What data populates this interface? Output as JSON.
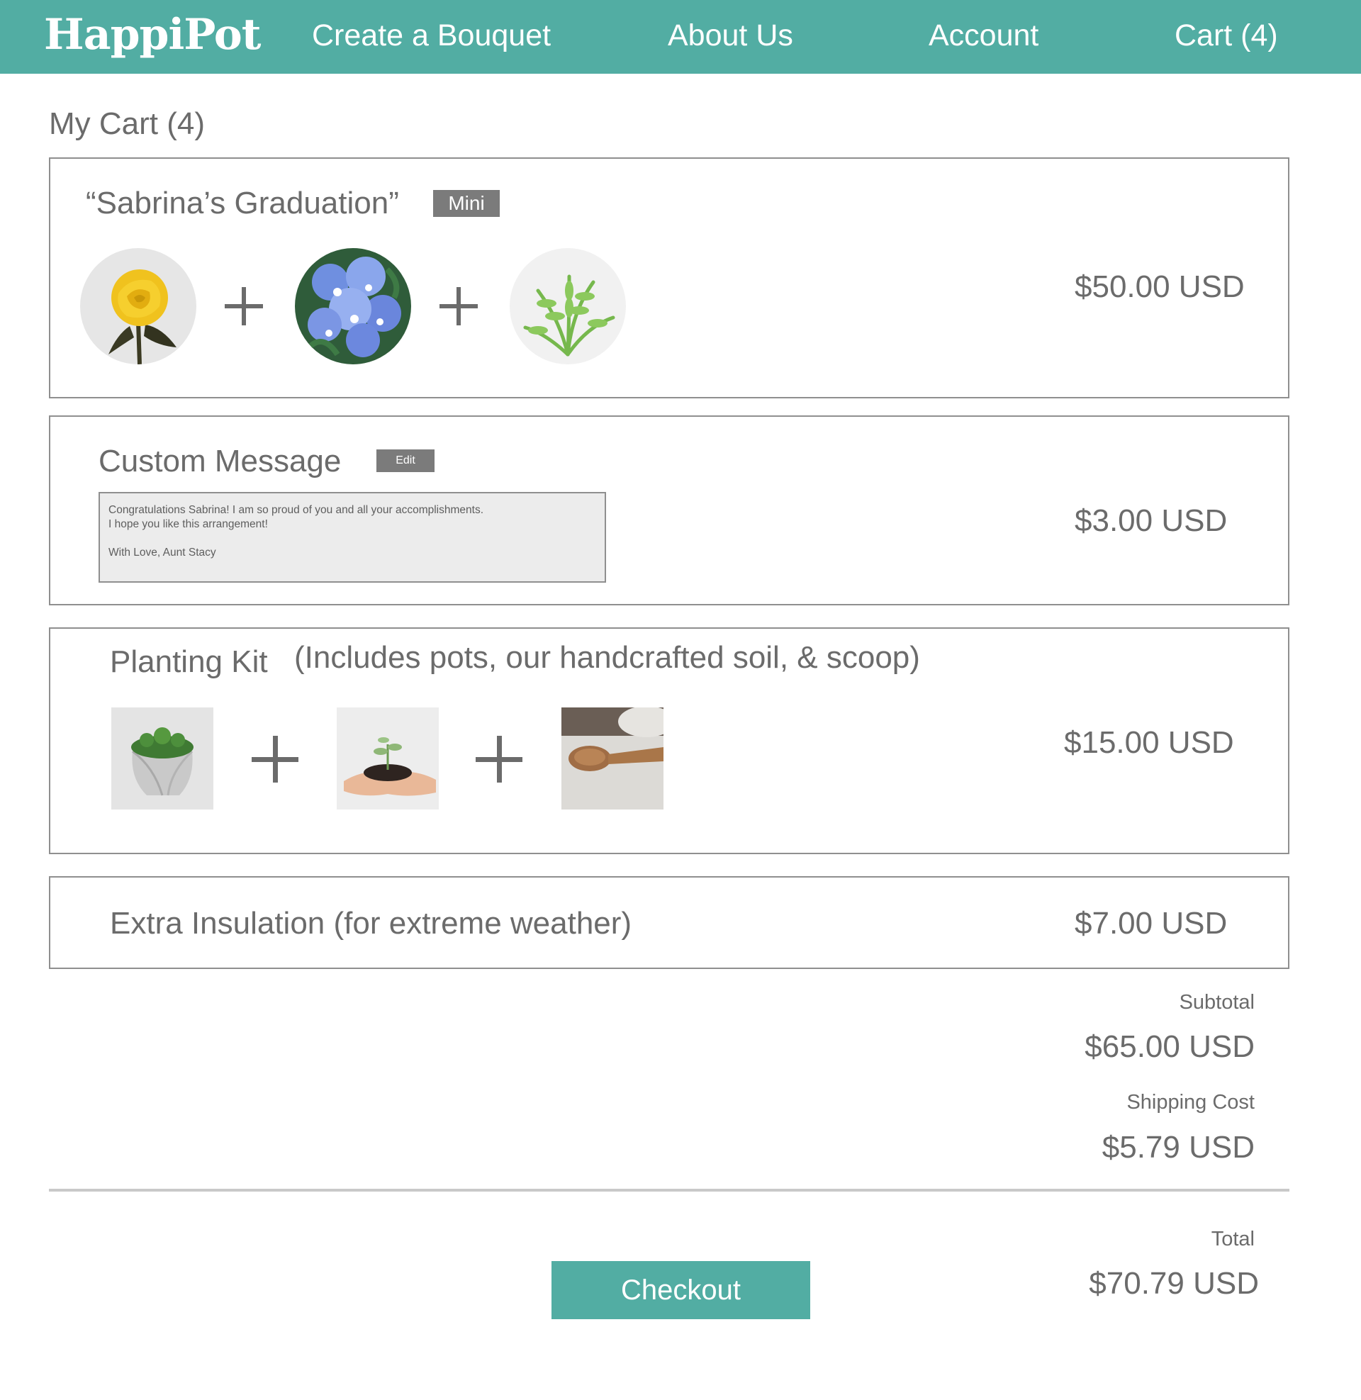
{
  "header": {
    "logo": "HappiPot",
    "nav": {
      "create": "Create a Bouquet",
      "about": "About Us",
      "account": "Account",
      "cart": "Cart (4)"
    }
  },
  "page_title": "My Cart (4)",
  "bouquet": {
    "name": "“Sabrina’s Graduation”",
    "size_tag": "Mini",
    "price": "$50.00 USD",
    "flowers": [
      "yellow-rose",
      "blue-forget-me-not",
      "green-fern"
    ]
  },
  "message": {
    "title": "Custom Message",
    "edit_label": "Edit",
    "price": "$3.00 USD",
    "lines": [
      "Congratulations Sabrina! I am so proud of you and all your accomplishments.",
      "I hope you like this arrangement!",
      "With Love, Aunt Stacy"
    ]
  },
  "planting_kit": {
    "title": "Planting Kit",
    "description": "(Includes pots, our handcrafted soil, & scoop)",
    "price": "$15.00 USD",
    "items": [
      "pot-with-moss",
      "hands-with-soil-sprout",
      "wooden-scoop"
    ]
  },
  "insulation": {
    "title": "Extra Insulation (for extreme weather)",
    "price": "$7.00 USD"
  },
  "summary": {
    "subtotal_label": "Subtotal",
    "subtotal_value": "$65.00 USD",
    "shipping_label": "Shipping Cost",
    "shipping_value": "$5.79 USD",
    "total_label": "Total",
    "total_value": "$70.79 USD"
  },
  "checkout_label": "Checkout",
  "colors": {
    "brand": "#52ada3",
    "text": "#6b6b6b",
    "tag": "#7b7b7b",
    "border": "#8f8f8f"
  }
}
